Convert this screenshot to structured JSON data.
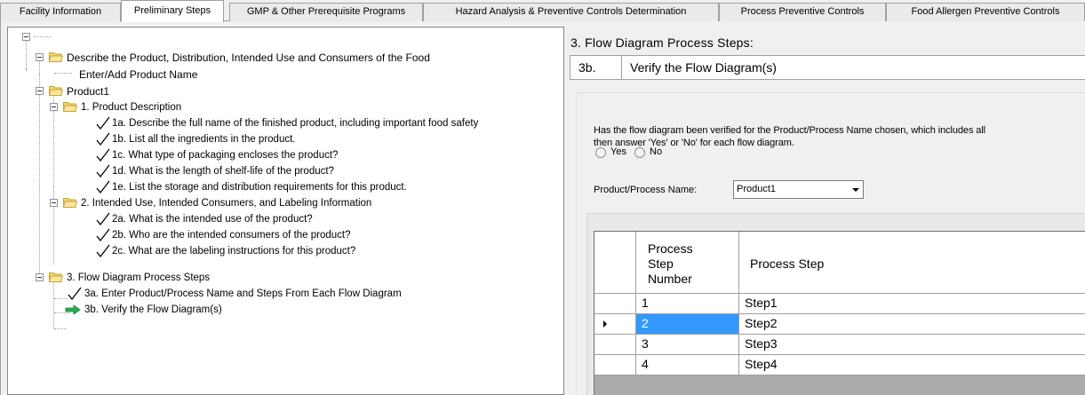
{
  "tabs": [
    {
      "label": "Facility Information"
    },
    {
      "label": "Preliminary Steps"
    },
    {
      "label": "GMP & Other Prerequisite Programs"
    },
    {
      "label": "Hazard Analysis & Preventive Controls Determination"
    },
    {
      "label": "Process Preventive Controls"
    },
    {
      "label": "Food Allergen Preventive Controls"
    }
  ],
  "tree": {
    "describe": "Describe the Product, Distribution, Intended Use and Consumers of the Food",
    "enter_name": "Enter/Add Product Name",
    "product": "Product1",
    "s1": "1. Product Description",
    "s1a": "1a. Describe the full name of the finished product, including important food safety",
    "s1b": "1b. List all the ingredients in the product.",
    "s1c": "1c. What type of packaging encloses the product?",
    "s1d": "1d. What is the length of shelf-life of the product?",
    "s1e": "1e. List the storage and distribution requirements for this product.",
    "s2": "2. Intended Use, Intended Consumers, and Labeling Information",
    "s2a": "2a. What is the intended use of the product?",
    "s2b": "2b. Who are the intended consumers of the product?",
    "s2c": "2c. What are the labeling instructions for this product?",
    "s3": "3. Flow Diagram Process Steps",
    "s3a": "3a. Enter Product/Process Name and Steps From Each Flow Diagram",
    "s3b": "3b. Verify the Flow Diagram(s)"
  },
  "panel": {
    "title": "3. Flow Diagram Process Steps:",
    "sub_num": "3b.",
    "sub_text": "Verify the Flow Diagram(s)",
    "question_line1": "Has the flow diagram been verified for the Product/Process Name chosen, which includes all",
    "question_line2": "then answer 'Yes' or 'No' for each flow diagram.",
    "yes": "Yes",
    "no": "No",
    "pp_label": "Product/Process Name:",
    "pp_value": "Product1"
  },
  "grid": {
    "col1_line1": "Process",
    "col1_line2": "Step",
    "col1_line3": "Number",
    "col2": "Process Step",
    "rows": [
      {
        "num": "1",
        "step": "Step1"
      },
      {
        "num": "2",
        "step": "Step2"
      },
      {
        "num": "3",
        "step": "Step3"
      },
      {
        "num": "4",
        "step": "Step4"
      }
    ]
  },
  "colors": {
    "selection": "#3399ff",
    "check": "#000000",
    "arrow": "#22b14c",
    "folder": "#f5d66b"
  }
}
